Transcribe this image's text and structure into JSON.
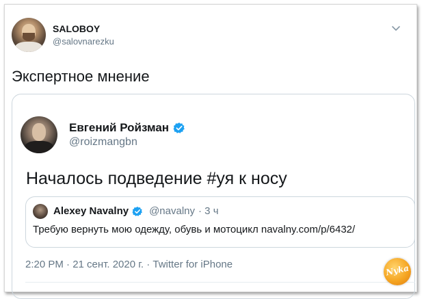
{
  "tweet": {
    "author_name": "SALOBOY",
    "author_handle": "@salovnarezku",
    "text": "Экспертное мнение"
  },
  "quoted_tweet": {
    "author_name": "Евгений Ройзман",
    "author_handle": "@roizmangbn",
    "text": "Началось подведение #уя к носу",
    "verified": true,
    "timestamp": "2:20 PM · 21 сент. 2020 г. · Twitter for iPhone"
  },
  "nested_quote": {
    "author_name": "Alexey Navalny",
    "author_handle": "@navalny",
    "time_ago": "· 3 ч",
    "text": "Требую вернуть мою одежду, обувь и мотоцикл navalny.com/p/6432/",
    "verified": true
  },
  "watermark": {
    "text": "Nyka"
  },
  "colors": {
    "text_primary": "#14171a",
    "text_secondary": "#657786",
    "verified_blue": "#1da1f2",
    "border": "#ccd6dd"
  },
  "icons": {
    "caret": "chevron-down-icon",
    "verified": "verified-badge-icon"
  }
}
